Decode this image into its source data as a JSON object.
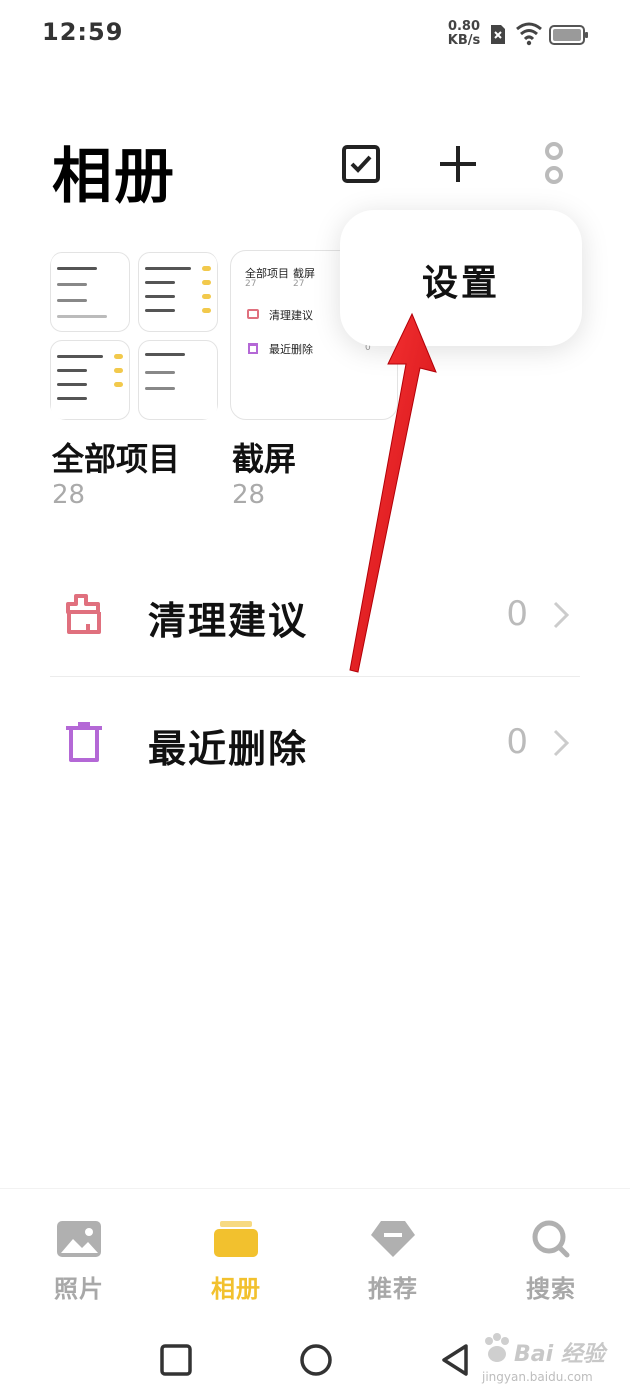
{
  "status_bar": {
    "time": "12:59",
    "net_speed_value": "0.80",
    "net_speed_unit": "KB/s",
    "icons": [
      "no-sim-icon",
      "wifi-icon",
      "battery-icon"
    ]
  },
  "header": {
    "title": "相册",
    "actions": [
      "select-checkbox-icon",
      "add-icon",
      "more-icon"
    ]
  },
  "popup_menu": {
    "items": [
      {
        "label": "设置"
      }
    ]
  },
  "albums": [
    {
      "name": "全部项目",
      "count": "28"
    },
    {
      "name": "截屏",
      "count": "28"
    }
  ],
  "album_previews": {
    "shot": {
      "col1_title": "全部项目",
      "col1_count": "27",
      "col2_title": "截屏",
      "col2_count": "27",
      "row1": "清理建议",
      "row2": "最近删除",
      "row2_count": "0"
    }
  },
  "list": [
    {
      "label": "清理建议",
      "count": "0",
      "icon": "broom-icon"
    },
    {
      "label": "最近删除",
      "count": "0",
      "icon": "trash-icon"
    }
  ],
  "tabs": [
    {
      "label": "照片",
      "icon": "photo-icon",
      "active": false
    },
    {
      "label": "相册",
      "icon": "album-icon",
      "active": true
    },
    {
      "label": "推荐",
      "icon": "gem-icon",
      "active": false
    },
    {
      "label": "搜索",
      "icon": "search-icon",
      "active": false
    }
  ],
  "watermark": {
    "text": "Bai 经验",
    "url": "jingyan.baidu.com"
  },
  "colors": {
    "accent": "#f2c12e",
    "clean_icon": "#e0707e",
    "trash_icon": "#b468d6",
    "annotation_arrow": "#e8141b"
  }
}
